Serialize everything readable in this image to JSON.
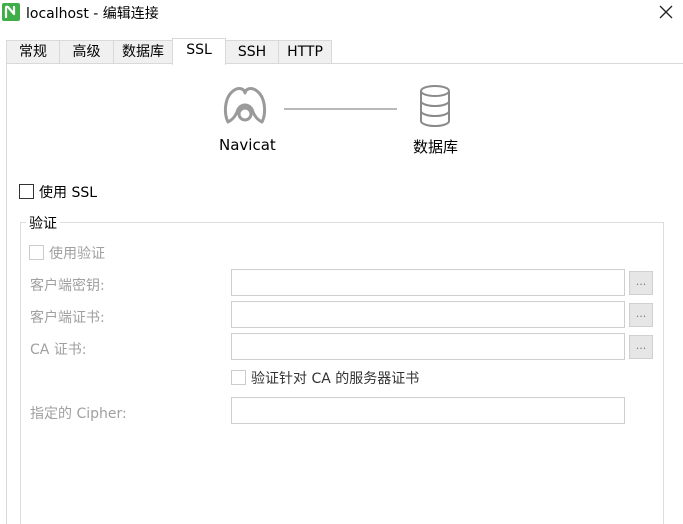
{
  "window": {
    "title": "localhost - 编辑连接",
    "icon": "navicat-logo-icon",
    "close_icon": "close-icon"
  },
  "tabs": [
    {
      "label": "常规",
      "active": false
    },
    {
      "label": "高级",
      "active": false
    },
    {
      "label": "数据库",
      "active": false
    },
    {
      "label": "SSL",
      "active": true
    },
    {
      "label": "SSH",
      "active": false
    },
    {
      "label": "HTTP",
      "active": false
    }
  ],
  "diagram": {
    "left_label": "Navicat",
    "right_label": "数据库",
    "left_icon": "navicat-seal-icon",
    "right_icon": "database-icon"
  },
  "ssl": {
    "use_ssl_label": "使用 SSL",
    "use_ssl_checked": false
  },
  "auth_group": {
    "title": "验证",
    "use_auth_label": "使用验证",
    "use_auth_checked": false,
    "client_key_label": "客户端密钥:",
    "client_key_value": "",
    "client_cert_label": "客户端证书:",
    "client_cert_value": "",
    "ca_cert_label": "CA 证书:",
    "ca_cert_value": "",
    "verify_ca_label": "验证针对 CA 的服务器证书",
    "verify_ca_checked": false,
    "cipher_label": "指定的 Cipher:",
    "cipher_value": "",
    "browse_label": "..."
  },
  "colors": {
    "accent_green": "#3fae49",
    "disabled_text": "#a0a0a0",
    "tab_bg": "#f0f0f0",
    "border": "#d9d9d9"
  }
}
